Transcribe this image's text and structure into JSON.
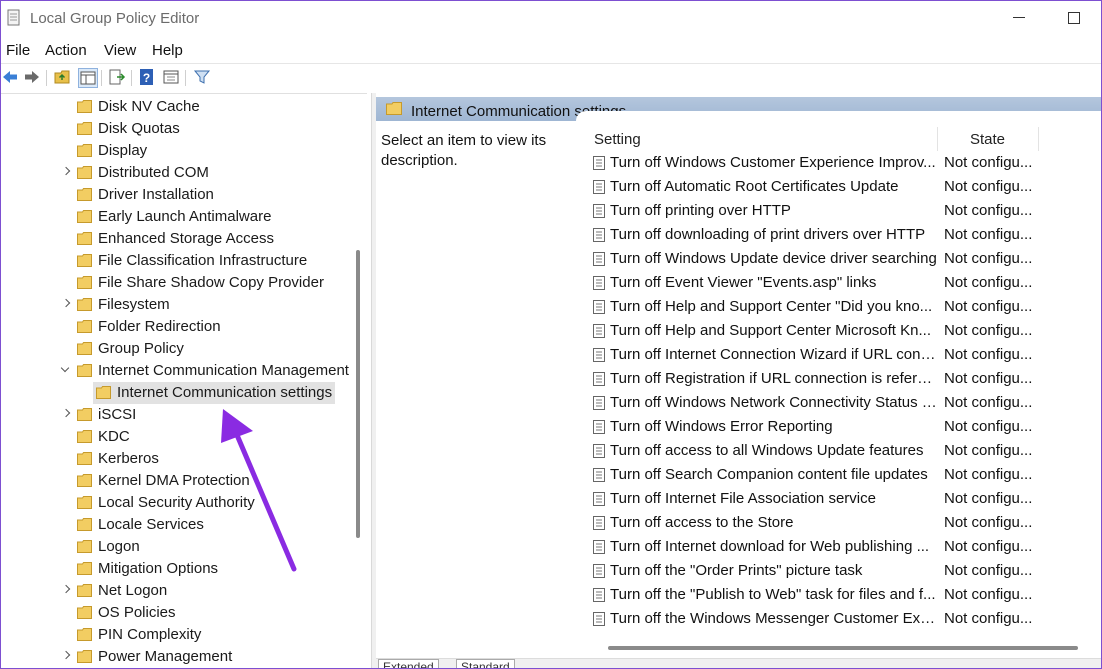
{
  "window": {
    "title": "Local Group Policy Editor"
  },
  "menubar": {
    "items": [
      "File",
      "Action",
      "View",
      "Help"
    ]
  },
  "toolbar": {
    "buttons": [
      "back-icon",
      "forward-icon",
      "up-folder-icon",
      "show-hide-tree-icon",
      "export-list-icon",
      "help-icon",
      "properties-icon",
      "filter-icon"
    ]
  },
  "tree": {
    "items": [
      {
        "label": "Disk NV Cache",
        "expandable": false
      },
      {
        "label": "Disk Quotas",
        "expandable": false
      },
      {
        "label": "Display",
        "expandable": false
      },
      {
        "label": "Distributed COM",
        "expandable": true
      },
      {
        "label": "Driver Installation",
        "expandable": false
      },
      {
        "label": "Early Launch Antimalware",
        "expandable": false
      },
      {
        "label": "Enhanced Storage Access",
        "expandable": false
      },
      {
        "label": "File Classification Infrastructure",
        "expandable": false
      },
      {
        "label": "File Share Shadow Copy Provider",
        "expandable": false
      },
      {
        "label": "Filesystem",
        "expandable": true
      },
      {
        "label": "Folder Redirection",
        "expandable": false
      },
      {
        "label": "Group Policy",
        "expandable": false
      },
      {
        "label": "Internet Communication Management",
        "expandable": true,
        "expanded": true
      },
      {
        "label": "Internet Communication settings",
        "child": true,
        "selected": true
      },
      {
        "label": "iSCSI",
        "expandable": true
      },
      {
        "label": "KDC",
        "expandable": false
      },
      {
        "label": "Kerberos",
        "expandable": false
      },
      {
        "label": "Kernel DMA Protection",
        "expandable": false
      },
      {
        "label": "Local Security Authority",
        "expandable": false
      },
      {
        "label": "Locale Services",
        "expandable": false
      },
      {
        "label": "Logon",
        "expandable": false
      },
      {
        "label": "Mitigation Options",
        "expandable": false
      },
      {
        "label": "Net Logon",
        "expandable": true
      },
      {
        "label": "OS Policies",
        "expandable": false
      },
      {
        "label": "PIN Complexity",
        "expandable": false
      },
      {
        "label": "Power Management",
        "expandable": true
      }
    ]
  },
  "details": {
    "header_title": "Internet Communication settings",
    "description": "Select an item to view its description.",
    "columns": {
      "setting": "Setting",
      "state": "State"
    },
    "rows": [
      {
        "setting": "Turn off Windows Customer Experience Improv...",
        "state": "Not configu..."
      },
      {
        "setting": "Turn off Automatic Root Certificates Update",
        "state": "Not configu..."
      },
      {
        "setting": "Turn off printing over HTTP",
        "state": "Not configu..."
      },
      {
        "setting": "Turn off downloading of print drivers over HTTP",
        "state": "Not configu..."
      },
      {
        "setting": "Turn off Windows Update device driver searching",
        "state": "Not configu..."
      },
      {
        "setting": "Turn off Event Viewer \"Events.asp\" links",
        "state": "Not configu..."
      },
      {
        "setting": "Turn off Help and Support Center \"Did you kno...",
        "state": "Not configu..."
      },
      {
        "setting": "Turn off Help and Support Center Microsoft Kn...",
        "state": "Not configu..."
      },
      {
        "setting": "Turn off Internet Connection Wizard if URL conn...",
        "state": "Not configu..."
      },
      {
        "setting": "Turn off Registration if URL connection is referri...",
        "state": "Not configu..."
      },
      {
        "setting": "Turn off Windows Network Connectivity Status I...",
        "state": "Not configu..."
      },
      {
        "setting": "Turn off Windows Error Reporting",
        "state": "Not configu..."
      },
      {
        "setting": "Turn off access to all Windows Update features",
        "state": "Not configu..."
      },
      {
        "setting": "Turn off Search Companion content file updates",
        "state": "Not configu..."
      },
      {
        "setting": "Turn off Internet File Association service",
        "state": "Not configu..."
      },
      {
        "setting": "Turn off access to the Store",
        "state": "Not configu..."
      },
      {
        "setting": "Turn off Internet download for Web publishing ...",
        "state": "Not configu..."
      },
      {
        "setting": "Turn off the \"Order Prints\" picture task",
        "state": "Not configu..."
      },
      {
        "setting": "Turn off the \"Publish to Web\" task for files and f...",
        "state": "Not configu..."
      },
      {
        "setting": "Turn off the Windows Messenger Customer Exp...",
        "state": "Not configu..."
      }
    ],
    "tabs": [
      "Extended",
      "Standard"
    ]
  },
  "colors": {
    "accent_border": "#7d4fd1",
    "annotation_arrow": "#8a2be2",
    "header_bar": "#a9bdd8",
    "selection": "#e2e2e2"
  }
}
